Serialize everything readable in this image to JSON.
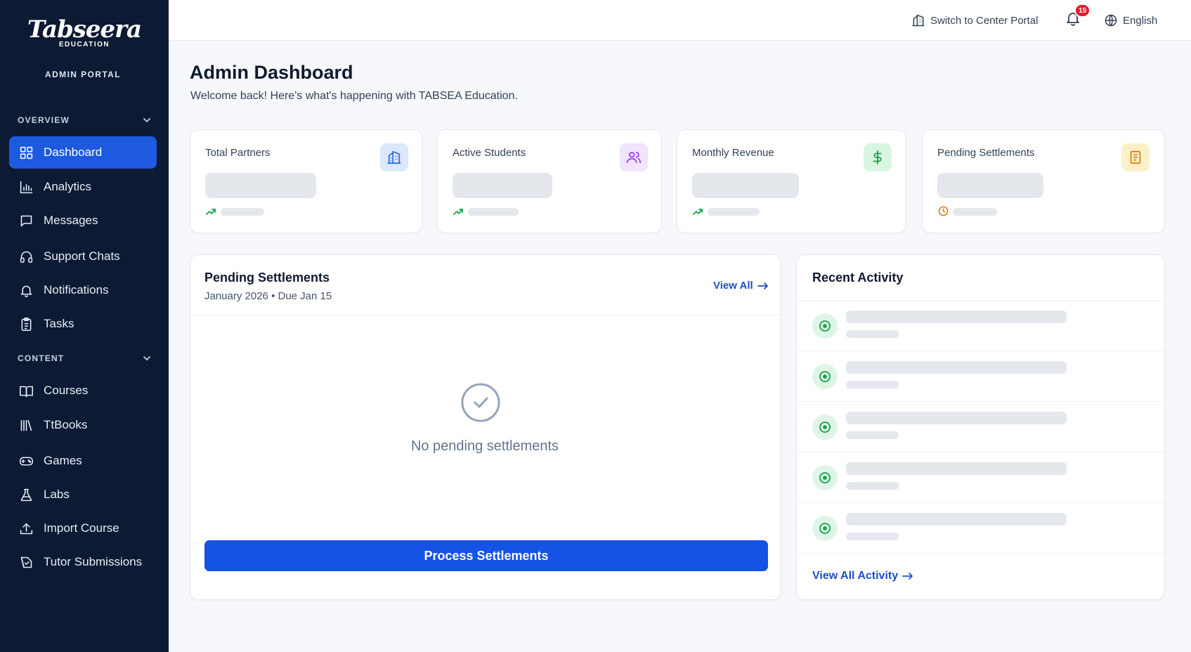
{
  "brand": {
    "logo_text": "Tabseera",
    "logo_sub": "EDUCATION",
    "portal_label": "ADMIN PORTAL"
  },
  "sidebar": {
    "sections": [
      {
        "label": "OVERVIEW"
      },
      {
        "label": "CONTENT"
      }
    ],
    "items": [
      {
        "label": "Dashboard",
        "icon": "dashboard-icon",
        "active": true
      },
      {
        "label": "Analytics",
        "icon": "bar-chart-icon"
      },
      {
        "label": "Messages",
        "icon": "message-icon"
      },
      {
        "label": "Support Chats",
        "icon": "headset-icon"
      },
      {
        "label": "Notifications",
        "icon": "bell-icon"
      },
      {
        "label": "Tasks",
        "icon": "clipboard-icon"
      },
      {
        "label": "Courses",
        "icon": "book-icon"
      },
      {
        "label": "TtBooks",
        "icon": "library-icon"
      },
      {
        "label": "Games",
        "icon": "gamepad-icon"
      },
      {
        "label": "Labs",
        "icon": "flask-icon"
      },
      {
        "label": "Import Course",
        "icon": "upload-icon"
      },
      {
        "label": "Tutor Submissions",
        "icon": "submission-icon"
      }
    ]
  },
  "topbar": {
    "switch_label": "Switch to Center Portal",
    "notification_count": "15",
    "language": "English"
  },
  "header": {
    "title": "Admin Dashboard",
    "subtitle": "Welcome back! Here's what's happening with TABSEA Education."
  },
  "stats": [
    {
      "label": "Total Partners",
      "icon": "building-icon",
      "color": "#2563eb",
      "bg": "#dbe8fd"
    },
    {
      "label": "Active Students",
      "icon": "users-icon",
      "color": "#9333ea",
      "bg": "#f1e4fd"
    },
    {
      "label": "Monthly Revenue",
      "icon": "dollar-icon",
      "color": "#16a34a",
      "bg": "#d9f6e3"
    },
    {
      "label": "Pending Settlements",
      "icon": "receipt-icon",
      "color": "#d97706",
      "bg": "#fdf0c8"
    }
  ],
  "settlements": {
    "title": "Pending Settlements",
    "subtitle": "January 2026 • Due Jan 15",
    "view_all": "View All",
    "empty_text": "No pending settlements",
    "process_button": "Process Settlements"
  },
  "activity": {
    "title": "Recent Activity",
    "view_all": "View All Activity"
  },
  "colors": {
    "sidebar": "#0c1a33",
    "accent": "#1d5ae0",
    "primary_button": "#1552e6"
  }
}
